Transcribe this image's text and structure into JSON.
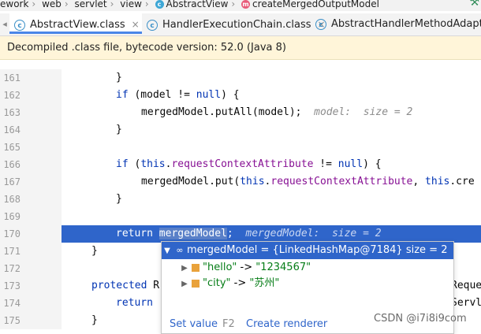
{
  "breadcrumb": {
    "items": [
      "ework",
      "web",
      "servlet",
      "view",
      "AbstractView",
      "createMergedOutputModel"
    ]
  },
  "tabs": [
    {
      "label": "AbstractView.class",
      "active": true
    },
    {
      "label": "HandlerExecutionChain.class",
      "active": false
    },
    {
      "label": "AbstractHandlerMethodAdapter.",
      "active": false
    }
  ],
  "notice": {
    "text": "Decompiled .class file, bytecode version: 52.0 (Java 8)"
  },
  "editor": {
    "lines": [
      {
        "n": "161"
      },
      {
        "n": "162"
      },
      {
        "n": "163"
      },
      {
        "n": "164"
      },
      {
        "n": "165"
      },
      {
        "n": "166"
      },
      {
        "n": "167"
      },
      {
        "n": "168"
      },
      {
        "n": "169"
      },
      {
        "n": "170"
      },
      {
        "n": "171"
      },
      {
        "n": "172"
      },
      {
        "n": "173"
      },
      {
        "n": "174"
      },
      {
        "n": "175"
      }
    ],
    "code": {
      "l161": "}",
      "l162_kw": "if",
      "l162_a": " (model != ",
      "l162_null": "null",
      "l162_b": ") {",
      "l163": "mergedModel.putAll(model);",
      "l163_hint": "model:  size = 2",
      "l164": "}",
      "l166_kw": "if",
      "l166_a": " (",
      "l166_this": "this",
      "l166_dot": ".",
      "l166_fld": "requestContextAttribute",
      "l166_b": " != ",
      "l166_null": "null",
      "l166_c": ") {",
      "l167_a": "mergedModel.put(",
      "l167_this": "this",
      "l167_dot": ".",
      "l167_fld": "requestContextAttribute",
      "l167_b": ", ",
      "l167_this2": "this",
      "l167_c": ".cre",
      "l168": "}",
      "l170_kw": "return",
      "l170_sel": "mergedModel",
      "l170_semi": ";",
      "l170_hint": "mergedModel:  size = 2",
      "l171": "}",
      "l173_kw": "protected",
      "l173_a": " R",
      "l173_tail": "Reque",
      "l174_kw": "return",
      "l174_tail": "Servl",
      "l175": "}"
    }
  },
  "debug_popup": {
    "root": "mergedModel = {LinkedHashMap@7184}  size = 2",
    "entries": [
      {
        "key": "\"hello\"",
        "arrow": " -> ",
        "value": "\"1234567\""
      },
      {
        "key": "\"city\"",
        "arrow": " -> ",
        "value": "\"苏州\""
      }
    ],
    "set_value": "Set value",
    "set_value_key": "F2",
    "create_renderer": "Create renderer"
  },
  "watermark": "CSDN @i7i8i9com",
  "colors": {
    "exec_line": "#2f65ca",
    "keyword": "#0033b3",
    "field": "#871094",
    "notice_bg": "#fff5d9"
  }
}
